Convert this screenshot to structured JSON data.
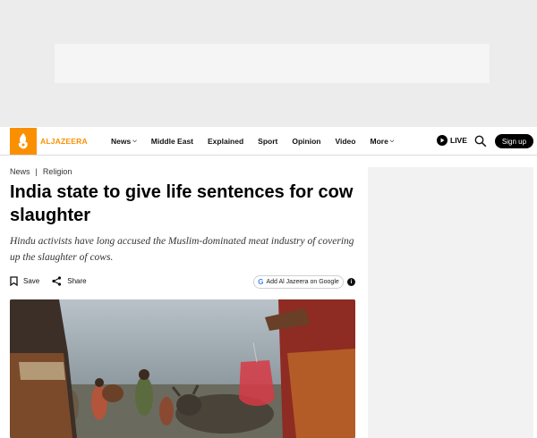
{
  "brand": {
    "name": "ALJAZEERA",
    "accent": "#fa9000"
  },
  "nav": {
    "items": [
      {
        "label": "News",
        "has_dropdown": true
      },
      {
        "label": "Middle East",
        "has_dropdown": false
      },
      {
        "label": "Explained",
        "has_dropdown": false
      },
      {
        "label": "Sport",
        "has_dropdown": false
      },
      {
        "label": "Opinion",
        "has_dropdown": false
      },
      {
        "label": "Video",
        "has_dropdown": false
      },
      {
        "label": "More",
        "has_dropdown": true
      }
    ],
    "live_label": "LIVE",
    "signup_label": "Sign up"
  },
  "breadcrumb": {
    "section": "News",
    "separator": "|",
    "topic": "Religion"
  },
  "article": {
    "headline": "India state to give life sentences for cow slaughter",
    "subhead": "Hindu activists have long accused the Muslim-dominated meat industry of covering up the slaughter of cows."
  },
  "actions": {
    "save_label": "Save",
    "share_label": "Share",
    "google_label": "Add Al Jazeera on Google",
    "info_label": "i"
  },
  "icons": {
    "logo": "aljazeera-logo-icon",
    "live": "play-icon",
    "search": "search-icon",
    "save": "bookmark-icon",
    "share": "share-icon",
    "google": "google-icon",
    "info": "info-icon"
  }
}
